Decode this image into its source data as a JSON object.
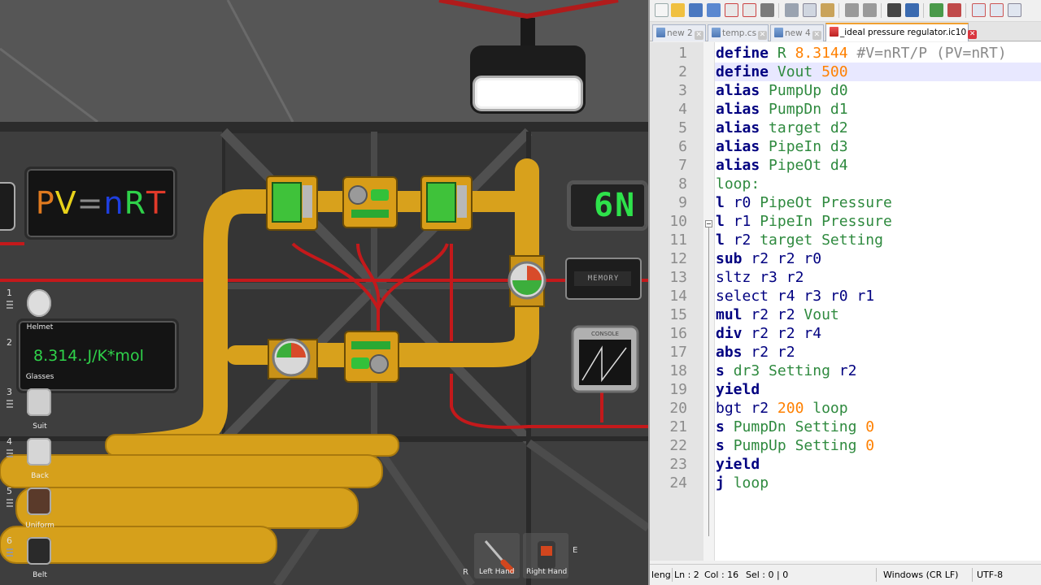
{
  "game": {
    "sign_pvnrt": [
      "P",
      "V",
      "=",
      "n",
      "R",
      "T"
    ],
    "sign_pvnrt_colors": [
      "#e07a1f",
      "#e8d21a",
      "#8a8a8a",
      "#1e3fe0",
      "#2fd24a",
      "#e23a2a"
    ],
    "sign_r_constant": "8.314..J/K*mol",
    "counter_display": "6N",
    "console_label": "CONSOLE",
    "memory_label": "MEMORY",
    "inventory": [
      {
        "slot": "1",
        "label": "Helmet"
      },
      {
        "slot": "2",
        "label": "Glasses"
      },
      {
        "slot": "3",
        "label": "Suit"
      },
      {
        "slot": "4",
        "label": "Back"
      },
      {
        "slot": "5",
        "label": "Uniform"
      },
      {
        "slot": "6",
        "label": "Belt"
      }
    ],
    "left_hand": {
      "key": "R",
      "label": "Left Hand"
    },
    "right_hand": {
      "key": "E",
      "label": "Right Hand"
    }
  },
  "editor": {
    "tabs": [
      {
        "label": "new 2",
        "active": false
      },
      {
        "label": "temp.cs",
        "active": false
      },
      {
        "label": "new 4",
        "active": false
      },
      {
        "label": "_ideal pressure regulator.ic10",
        "active": true
      }
    ],
    "current_line": 2,
    "code_lines": [
      "define R 8.3144 #V=nRT/P (PV=nRT)",
      "define Vout 500",
      "alias PumpUp d0",
      "alias PumpDn d1",
      "alias target d2",
      "alias PipeIn d3",
      "alias PipeOt d4",
      "loop:",
      "l r0 PipeOt Pressure",
      "l r1 PipeIn Pressure",
      "l r2 target Setting",
      "sub r2 r2 r0",
      "sltz r3 r2",
      "select r4 r3 r0 r1",
      "mul r2 r2 Vout",
      "div r2 r2 r4",
      "abs r2 r2",
      "s dr3 Setting r2",
      "yield",
      "bgt r2 200 loop",
      "s PumpDn Setting 0",
      "s PumpUp Setting 0",
      "yield",
      "j loop"
    ],
    "status": {
      "length": "leng",
      "ln": "Ln : 2",
      "col": "Col : 16",
      "sel": "Sel : 0 | 0",
      "eol": "Windows (CR LF)",
      "encoding": "UTF-8"
    }
  }
}
